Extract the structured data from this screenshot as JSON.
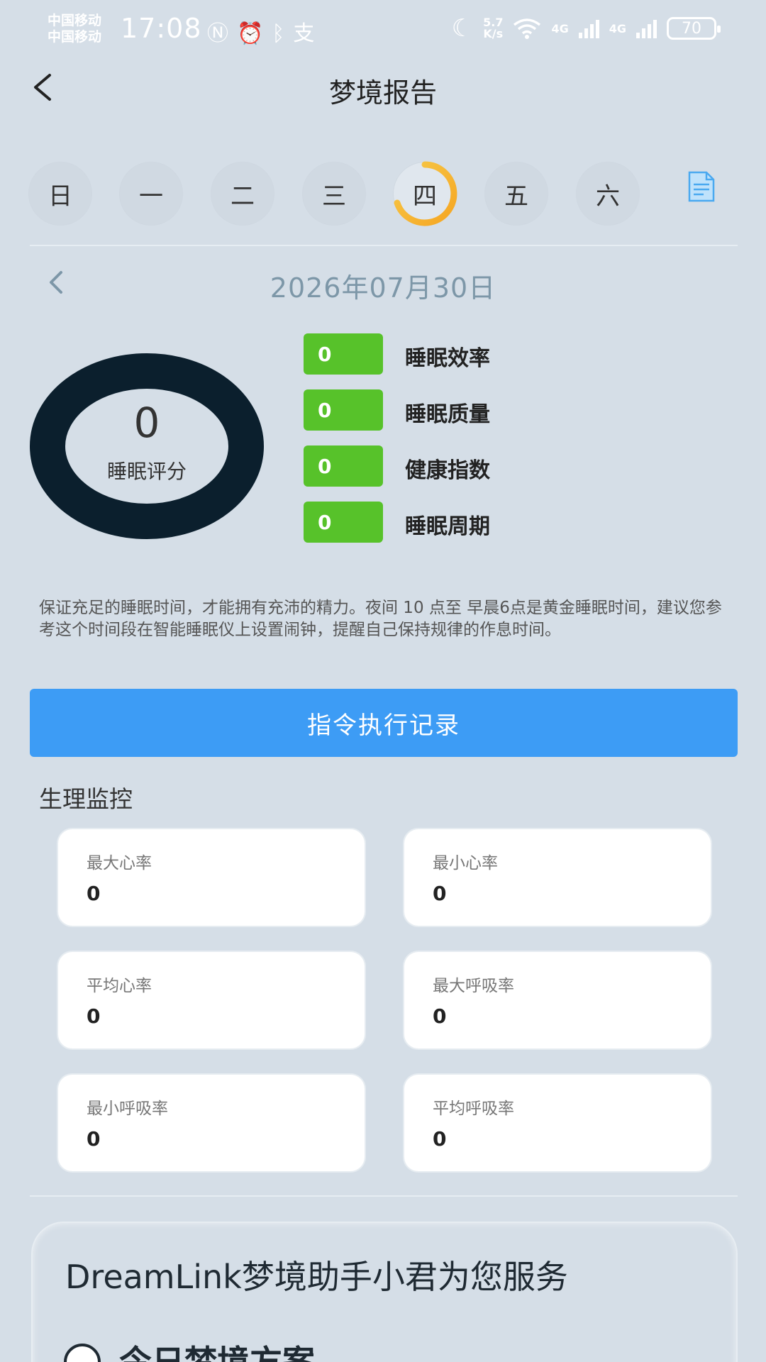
{
  "status_bar": {
    "carrier1": "中国移动",
    "carrier2": "中国移动",
    "time": "17:08",
    "left_icons": "Ⓝ⏰ᛒ支",
    "speed_top": "5.7",
    "speed_bottom": "K/s",
    "net1": "4G",
    "net2": "4G",
    "battery": "70",
    "icons": [
      "nfc-icon",
      "alarm-icon",
      "bluetooth-icon",
      "alipay-icon",
      "moon-icon",
      "wifi-icon",
      "signal-icon",
      "battery-icon"
    ]
  },
  "header": {
    "title": "梦境报告"
  },
  "week": {
    "days": [
      "日",
      "一",
      "二",
      "三",
      "四",
      "五",
      "六"
    ],
    "active_index": 4,
    "accent": "#f5a623"
  },
  "date": {
    "text": "2026年07月30日"
  },
  "score": {
    "value": "0",
    "label": "睡眠评分"
  },
  "metrics": [
    {
      "value": "0",
      "label": "睡眠效率"
    },
    {
      "value": "0",
      "label": "睡眠质量"
    },
    {
      "value": "0",
      "label": "健康指数"
    },
    {
      "value": "0",
      "label": "睡眠周期"
    }
  ],
  "description": "保证充足的睡眠时间，才能拥有充沛的精力。夜间 10 点至 早晨6点是黄金睡眠时间，建议您参考这个时间段在智能睡眠仪上设置闹钟，提醒自己保持规律的作息时间。",
  "command_button": {
    "label": "指令执行记录"
  },
  "vitals": {
    "title": "生理监控",
    "cards": [
      {
        "label": "最大心率",
        "value": "0"
      },
      {
        "label": "最小心率",
        "value": "0"
      },
      {
        "label": "平均心率",
        "value": "0"
      },
      {
        "label": "最大呼吸率",
        "value": "0"
      },
      {
        "label": "最小呼吸率",
        "value": "0"
      },
      {
        "label": "平均呼吸率",
        "value": "0"
      }
    ]
  },
  "assistant": {
    "title": "DreamLink梦境助手小君为您服务",
    "option_label": "今日梦境方案"
  },
  "colors": {
    "background": "#d5dee7",
    "primary": "#3d9cf5",
    "metric_green": "#57c22a",
    "donut": "#0b1f2d"
  }
}
